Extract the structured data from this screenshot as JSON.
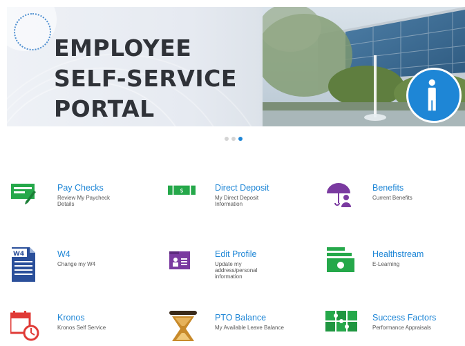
{
  "banner": {
    "title_lines": [
      "EMPLOYEE",
      "SELF-SERVICE",
      "PORTAL"
    ]
  },
  "carousel": {
    "slides": 3,
    "active": 3
  },
  "tiles": [
    {
      "title": "Pay Checks",
      "desc": "Review My Paycheck Details",
      "icon": "paycheck-icon"
    },
    {
      "title": "Direct Deposit",
      "desc": "My Direct Deposit Information",
      "icon": "money-icon"
    },
    {
      "title": "Benefits",
      "desc": "Current Benefits",
      "icon": "umbrella-person-icon"
    },
    {
      "title": "W4",
      "desc": "Change my W4",
      "icon": "w4-document-icon"
    },
    {
      "title": "Edit Profile",
      "desc": "Update my address/personal information",
      "icon": "id-card-icon"
    },
    {
      "title": "Healthstream",
      "desc": "E-Learning",
      "icon": "stacked-trays-icon"
    },
    {
      "title": "Kronos",
      "desc": "Kronos Self Service",
      "icon": "calendar-clock-icon"
    },
    {
      "title": "PTO Balance",
      "desc": "My Available Leave Balance",
      "icon": "hourglass-icon"
    },
    {
      "title": "Success Factors",
      "desc": "Performance Appraisals",
      "icon": "puzzle-icon"
    }
  ],
  "colors": {
    "link": "#1e86d6",
    "green": "#25a84a",
    "purple": "#7a3aa0",
    "navy": "#2a4f9a",
    "red": "#e03a36",
    "gold": "#c88a2a"
  }
}
